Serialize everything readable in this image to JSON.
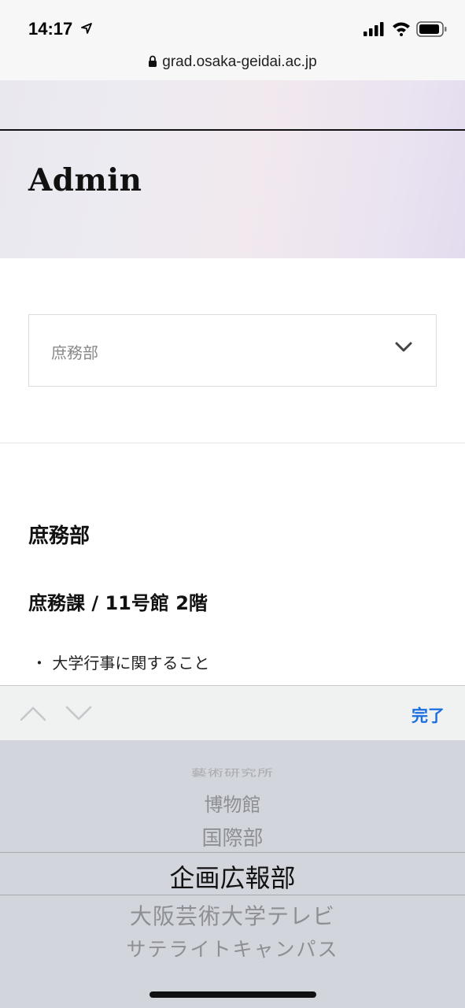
{
  "status_bar": {
    "time": "14:17"
  },
  "browser": {
    "url": "grad.osaka-geidai.ac.jp"
  },
  "hero": {
    "title": "Admin"
  },
  "department_select": {
    "value": "庶務部"
  },
  "content": {
    "section_heading": "庶務部",
    "subsection_heading": "庶務課 / 11号館 2階",
    "list_item": "・ 大学行事に関すること"
  },
  "accessory_bar": {
    "done_label": "完了"
  },
  "picker": {
    "rows": [
      "藝術研究所",
      "博物館",
      "国際部",
      "企画広報部",
      "大阪芸術大学テレビ",
      "サテライトキャンパス"
    ],
    "selected": "企画広報部"
  },
  "colors": {
    "accent": "#1a6ee0",
    "picker_bg": "#d2d5db"
  }
}
